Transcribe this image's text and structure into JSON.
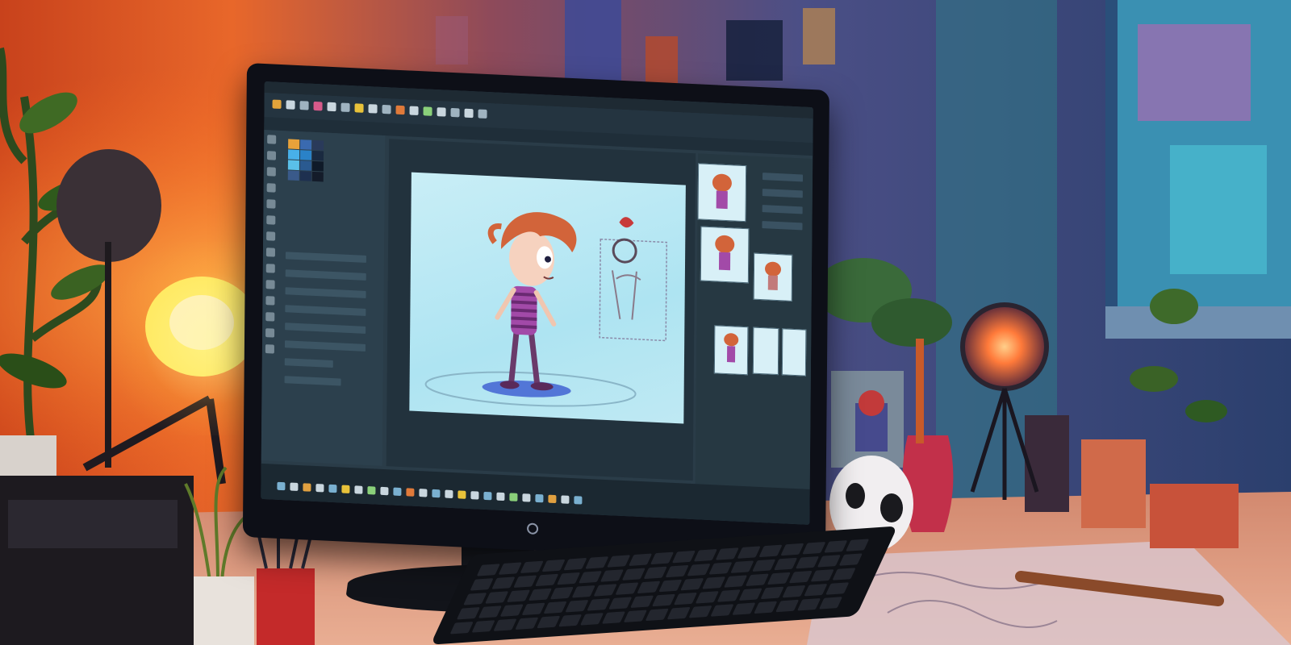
{
  "scene": {
    "description_colors": {
      "wall_warm": "#e8672a",
      "wall_cool": "#3f4f8a",
      "window_glow": "#3fb0c8",
      "lamp": "#fff28a",
      "screen_ui": "#2a3c48",
      "canvas": "#bfe9f3"
    }
  },
  "monitor": {
    "app_title": "",
    "icons": [
      "brush-tool-icon",
      "pencil-tool-icon",
      "eraser-tool-icon",
      "fill-tool-icon",
      "selection-tool-icon",
      "layers-icon",
      "color-picker-icon",
      "play-icon"
    ]
  }
}
